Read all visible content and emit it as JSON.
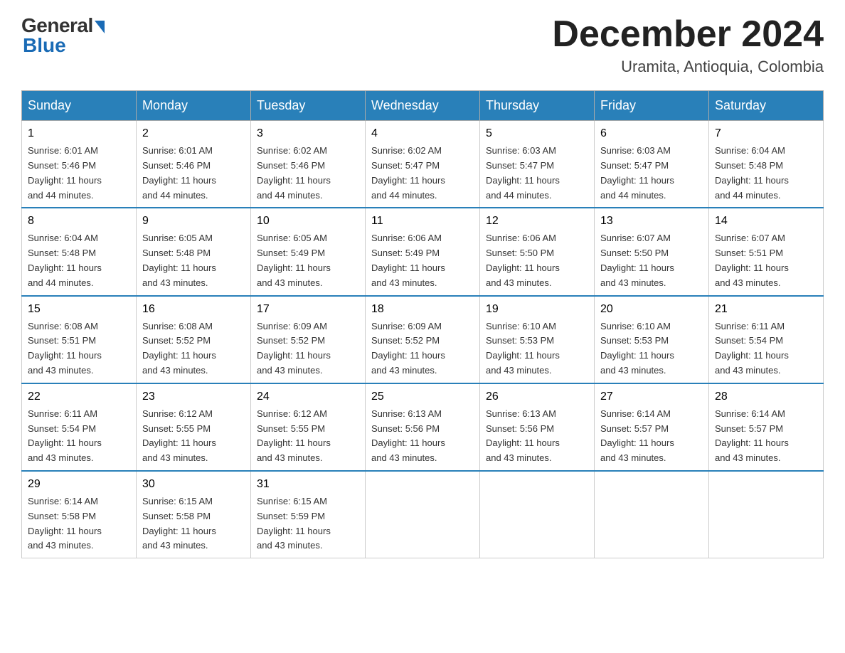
{
  "header": {
    "logo_general": "General",
    "logo_blue": "Blue",
    "month_title": "December 2024",
    "location": "Uramita, Antioquia, Colombia"
  },
  "days_of_week": [
    "Sunday",
    "Monday",
    "Tuesday",
    "Wednesday",
    "Thursday",
    "Friday",
    "Saturday"
  ],
  "weeks": [
    [
      {
        "day": "1",
        "sunrise": "6:01 AM",
        "sunset": "5:46 PM",
        "daylight": "11 hours and 44 minutes."
      },
      {
        "day": "2",
        "sunrise": "6:01 AM",
        "sunset": "5:46 PM",
        "daylight": "11 hours and 44 minutes."
      },
      {
        "day": "3",
        "sunrise": "6:02 AM",
        "sunset": "5:46 PM",
        "daylight": "11 hours and 44 minutes."
      },
      {
        "day": "4",
        "sunrise": "6:02 AM",
        "sunset": "5:47 PM",
        "daylight": "11 hours and 44 minutes."
      },
      {
        "day": "5",
        "sunrise": "6:03 AM",
        "sunset": "5:47 PM",
        "daylight": "11 hours and 44 minutes."
      },
      {
        "day": "6",
        "sunrise": "6:03 AM",
        "sunset": "5:47 PM",
        "daylight": "11 hours and 44 minutes."
      },
      {
        "day": "7",
        "sunrise": "6:04 AM",
        "sunset": "5:48 PM",
        "daylight": "11 hours and 44 minutes."
      }
    ],
    [
      {
        "day": "8",
        "sunrise": "6:04 AM",
        "sunset": "5:48 PM",
        "daylight": "11 hours and 44 minutes."
      },
      {
        "day": "9",
        "sunrise": "6:05 AM",
        "sunset": "5:48 PM",
        "daylight": "11 hours and 43 minutes."
      },
      {
        "day": "10",
        "sunrise": "6:05 AM",
        "sunset": "5:49 PM",
        "daylight": "11 hours and 43 minutes."
      },
      {
        "day": "11",
        "sunrise": "6:06 AM",
        "sunset": "5:49 PM",
        "daylight": "11 hours and 43 minutes."
      },
      {
        "day": "12",
        "sunrise": "6:06 AM",
        "sunset": "5:50 PM",
        "daylight": "11 hours and 43 minutes."
      },
      {
        "day": "13",
        "sunrise": "6:07 AM",
        "sunset": "5:50 PM",
        "daylight": "11 hours and 43 minutes."
      },
      {
        "day": "14",
        "sunrise": "6:07 AM",
        "sunset": "5:51 PM",
        "daylight": "11 hours and 43 minutes."
      }
    ],
    [
      {
        "day": "15",
        "sunrise": "6:08 AM",
        "sunset": "5:51 PM",
        "daylight": "11 hours and 43 minutes."
      },
      {
        "day": "16",
        "sunrise": "6:08 AM",
        "sunset": "5:52 PM",
        "daylight": "11 hours and 43 minutes."
      },
      {
        "day": "17",
        "sunrise": "6:09 AM",
        "sunset": "5:52 PM",
        "daylight": "11 hours and 43 minutes."
      },
      {
        "day": "18",
        "sunrise": "6:09 AM",
        "sunset": "5:52 PM",
        "daylight": "11 hours and 43 minutes."
      },
      {
        "day": "19",
        "sunrise": "6:10 AM",
        "sunset": "5:53 PM",
        "daylight": "11 hours and 43 minutes."
      },
      {
        "day": "20",
        "sunrise": "6:10 AM",
        "sunset": "5:53 PM",
        "daylight": "11 hours and 43 minutes."
      },
      {
        "day": "21",
        "sunrise": "6:11 AM",
        "sunset": "5:54 PM",
        "daylight": "11 hours and 43 minutes."
      }
    ],
    [
      {
        "day": "22",
        "sunrise": "6:11 AM",
        "sunset": "5:54 PM",
        "daylight": "11 hours and 43 minutes."
      },
      {
        "day": "23",
        "sunrise": "6:12 AM",
        "sunset": "5:55 PM",
        "daylight": "11 hours and 43 minutes."
      },
      {
        "day": "24",
        "sunrise": "6:12 AM",
        "sunset": "5:55 PM",
        "daylight": "11 hours and 43 minutes."
      },
      {
        "day": "25",
        "sunrise": "6:13 AM",
        "sunset": "5:56 PM",
        "daylight": "11 hours and 43 minutes."
      },
      {
        "day": "26",
        "sunrise": "6:13 AM",
        "sunset": "5:56 PM",
        "daylight": "11 hours and 43 minutes."
      },
      {
        "day": "27",
        "sunrise": "6:14 AM",
        "sunset": "5:57 PM",
        "daylight": "11 hours and 43 minutes."
      },
      {
        "day": "28",
        "sunrise": "6:14 AM",
        "sunset": "5:57 PM",
        "daylight": "11 hours and 43 minutes."
      }
    ],
    [
      {
        "day": "29",
        "sunrise": "6:14 AM",
        "sunset": "5:58 PM",
        "daylight": "11 hours and 43 minutes."
      },
      {
        "day": "30",
        "sunrise": "6:15 AM",
        "sunset": "5:58 PM",
        "daylight": "11 hours and 43 minutes."
      },
      {
        "day": "31",
        "sunrise": "6:15 AM",
        "sunset": "5:59 PM",
        "daylight": "11 hours and 43 minutes."
      },
      null,
      null,
      null,
      null
    ]
  ],
  "labels": {
    "sunrise": "Sunrise:",
    "sunset": "Sunset:",
    "daylight": "Daylight:"
  }
}
